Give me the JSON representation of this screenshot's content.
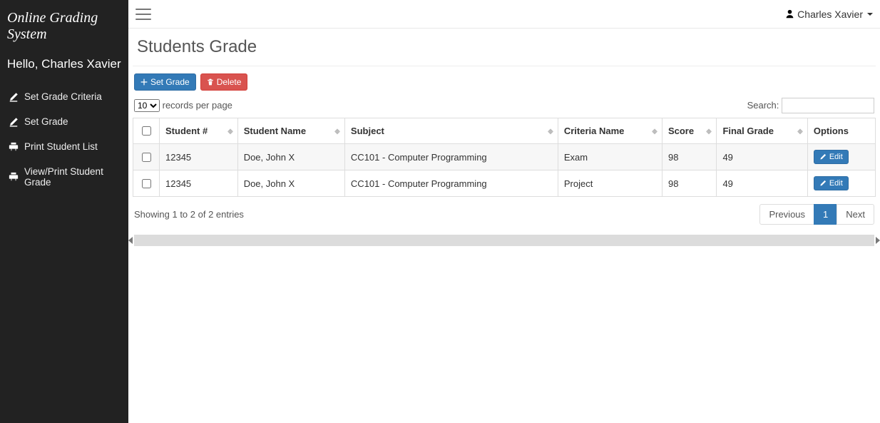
{
  "sidebar": {
    "brand": "Online Grading System",
    "greeting": "Hello, Charles Xavier",
    "items": [
      {
        "label": "Set Grade Criteria",
        "icon": "edit-icon"
      },
      {
        "label": "Set Grade",
        "icon": "edit-icon"
      },
      {
        "label": "Print Student List",
        "icon": "print-icon"
      },
      {
        "label": "View/Print Student Grade",
        "icon": "print-icon"
      }
    ]
  },
  "topbar": {
    "username": "Charles Xavier"
  },
  "page": {
    "title": "Students Grade"
  },
  "toolbar": {
    "set_grade_label": "Set Grade",
    "delete_label": "Delete"
  },
  "datatable": {
    "length_value": "10",
    "length_suffix": "records per page",
    "search_label": "Search:",
    "search_value": "",
    "columns": {
      "student_no": "Student #",
      "student_name": "Student Name",
      "subject": "Subject",
      "criteria": "Criteria Name",
      "score": "Score",
      "final_grade": "Final Grade",
      "options": "Options"
    },
    "rows": [
      {
        "student_no": "12345",
        "student_name": "Doe, John X",
        "subject": "CC101 - Computer Programming",
        "criteria": "Exam",
        "score": "98",
        "final_grade": "49",
        "edit_label": "Edit"
      },
      {
        "student_no": "12345",
        "student_name": "Doe, John X",
        "subject": "CC101 - Computer Programming",
        "criteria": "Project",
        "score": "98",
        "final_grade": "49",
        "edit_label": "Edit"
      }
    ],
    "info": "Showing 1 to 2 of 2 entries",
    "pagination": {
      "previous": "Previous",
      "next": "Next",
      "current": "1"
    }
  }
}
